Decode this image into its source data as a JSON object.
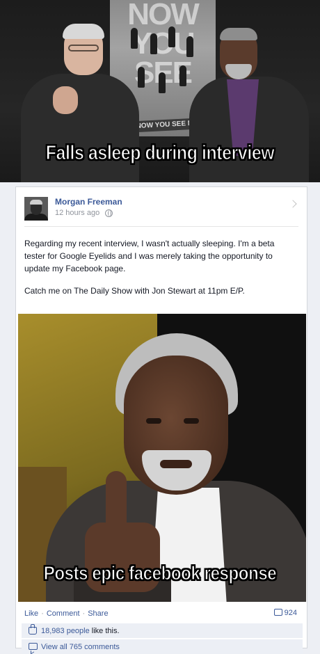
{
  "meme": {
    "top_caption": "Falls asleep during interview",
    "bottom_caption": "Posts epic facebook response",
    "poster_caption": "NOW YOU SEE M"
  },
  "post": {
    "author": "Morgan Freeman",
    "timestamp": "12 hours ago",
    "paragraph_1": "Regarding my recent interview, I wasn't actually sleeping. I'm a beta tester for Google Eyelids and I was merely taking the opportunity to update my Facebook page.",
    "paragraph_2": "Catch me on The Daily Show with Jon Stewart at 11pm E/P."
  },
  "actions": {
    "like": "Like",
    "comment": "Comment",
    "share": "Share",
    "separator": "·",
    "comment_count": "924"
  },
  "feedback": {
    "likes_count": "18,983 people",
    "likes_suffix": " like this.",
    "view_comments": "View all 765 comments"
  },
  "icons": {
    "privacy": "globe-icon",
    "like": "thumbs-up-icon",
    "comment": "speech-bubble-icon"
  },
  "colors": {
    "link_blue": "#3b5998",
    "meta_gray": "#90949c",
    "feedback_bg": "#eceff5"
  }
}
